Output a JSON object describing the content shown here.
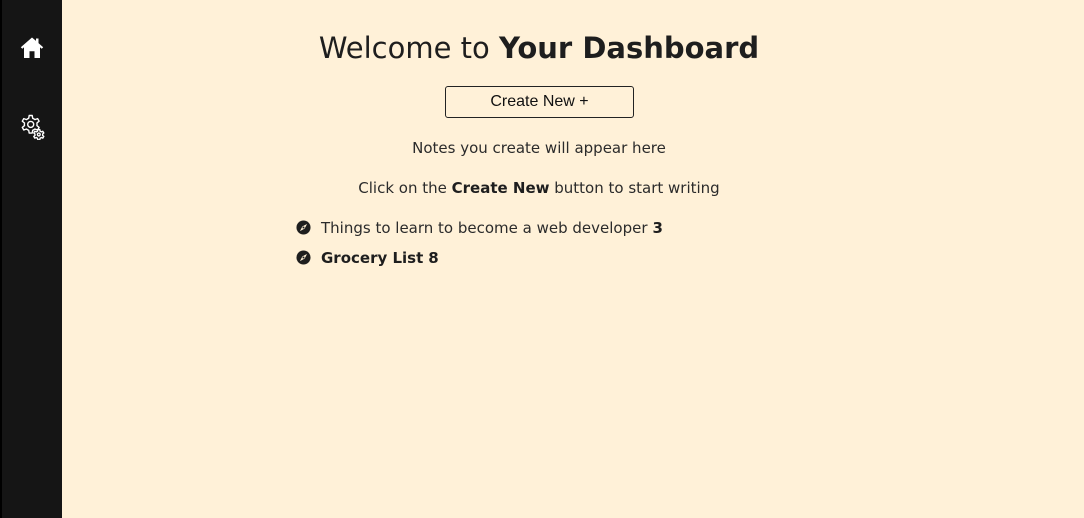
{
  "sidebar": {
    "items": [
      {
        "icon": "home-icon",
        "label": ""
      },
      {
        "icon": "gear-icon",
        "label": ""
      }
    ],
    "icon_color": "#ffffff",
    "background": "#151515"
  },
  "main": {
    "title_prefix": "Welcome to ",
    "title_bold": "Your Dashboard",
    "create_button_label": "Create New +",
    "empty_line1": "Notes you create will appear here",
    "empty_line2_prefix": "Click on the ",
    "empty_line2_bold": "Create New",
    "empty_line2_suffix": " button to start writing",
    "background": "#fff1d8"
  },
  "notes": [
    {
      "title": "Things to learn to become a web developer",
      "count": "3",
      "icon": "compass-icon",
      "title_bold": false
    },
    {
      "title": "Grocery List",
      "count": "8",
      "icon": "compass-icon",
      "title_bold": true
    }
  ]
}
